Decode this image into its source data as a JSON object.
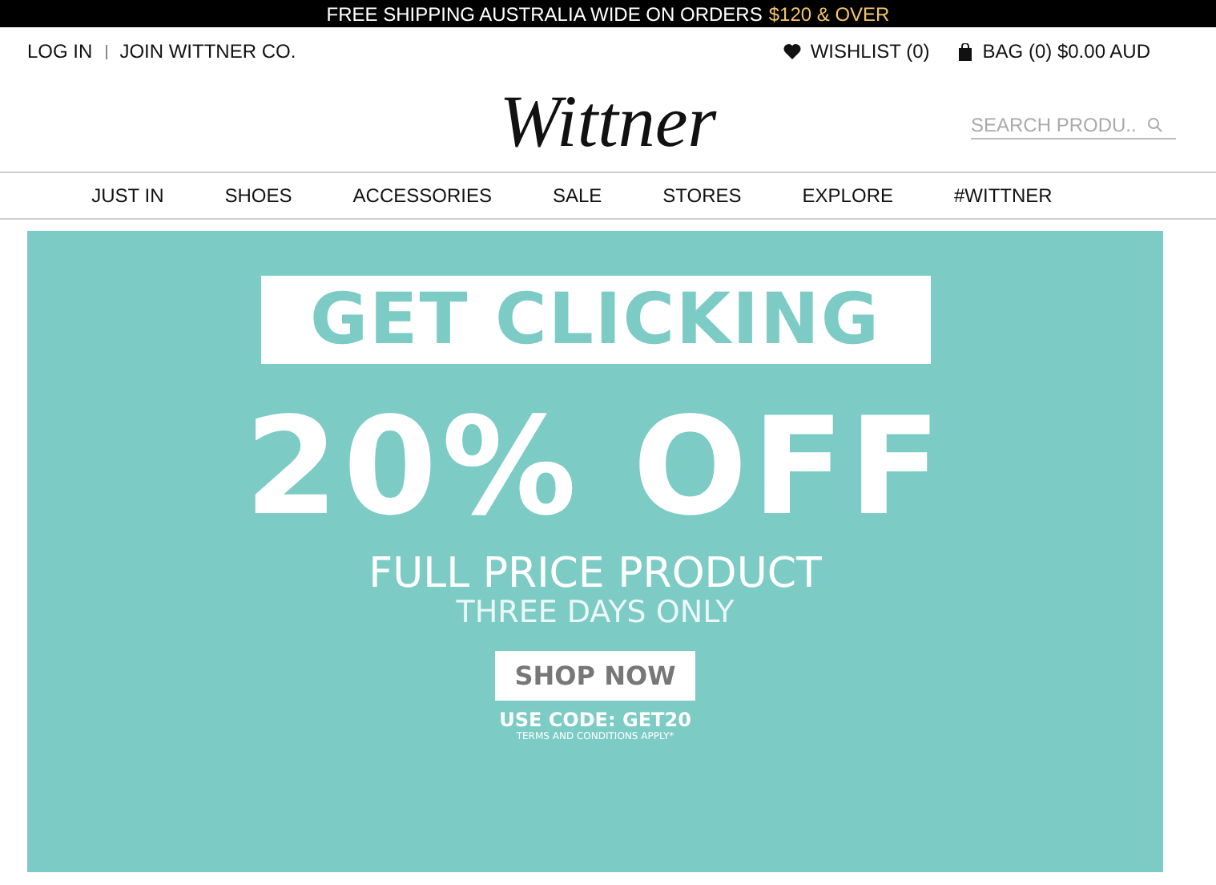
{
  "promo_bar": {
    "text": "FREE SHIPPING AUSTRALIA WIDE ON ORDERS",
    "highlight": "$120 & OVER"
  },
  "account_links": [
    "LOG IN",
    "JOIN WITTNER CO."
  ],
  "wishlist": "WISHLIST (0)",
  "bag": "BAG (0) $0.00 AUD",
  "logo": "Wittner",
  "search": {
    "placeholder": "SEARCH PRODU.."
  },
  "nav": [
    "JUST IN",
    "SHOES",
    "ACCESSORIES",
    "SALE",
    "STORES",
    "EXPLORE",
    "#WITTNER"
  ],
  "hero": {
    "headline": "GET CLICKING",
    "offer": "20% OFF",
    "subtitle": "FULL PRICE PRODUCT",
    "duration": "THREE DAYS ONLY",
    "button": "SHOP NOW",
    "code": "USE CODE: GET20",
    "terms": "TERMS AND CONDITIONS APPLY*"
  }
}
